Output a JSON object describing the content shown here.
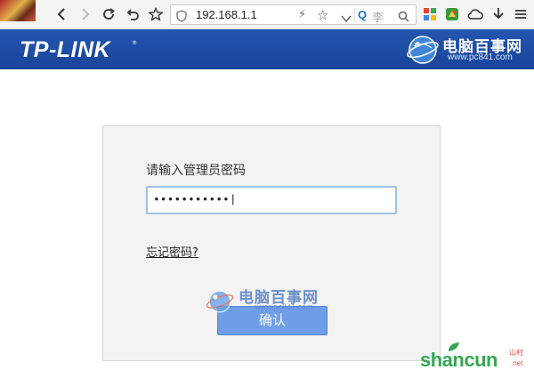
{
  "browser": {
    "url": "192.168.1.1",
    "search_placeholder": "李",
    "icons": [
      "back-icon",
      "forward-icon",
      "reload-icon",
      "undo-icon",
      "bookmark-star-icon",
      "shield-icon",
      "lightning-icon",
      "star-icon",
      "search-icon",
      "apps-icon",
      "extension-icon",
      "cloud-icon",
      "download-icon",
      "menu-icon"
    ]
  },
  "header": {
    "logo": "TP-LINK",
    "logo_mark": "®",
    "watermark_cn": "电脑百事网",
    "watermark_en": "www.pc841.com"
  },
  "login": {
    "prompt": "请输入管理员密码",
    "password_value": "•••••••••••|",
    "forgot_link": "忘记密码?",
    "confirm_button": "确认"
  },
  "overlay": {
    "center_cn": "电脑百事网",
    "center_en": "www.pc841.com",
    "corner_text": "shancun",
    "corner_cn": "山村",
    "corner_net": ".net"
  },
  "colors": {
    "header_blue": "#1d4ba0",
    "button_blue": "#6e9ee8",
    "input_focus": "#9ec3ea",
    "panel_bg": "#f3f3f3"
  }
}
